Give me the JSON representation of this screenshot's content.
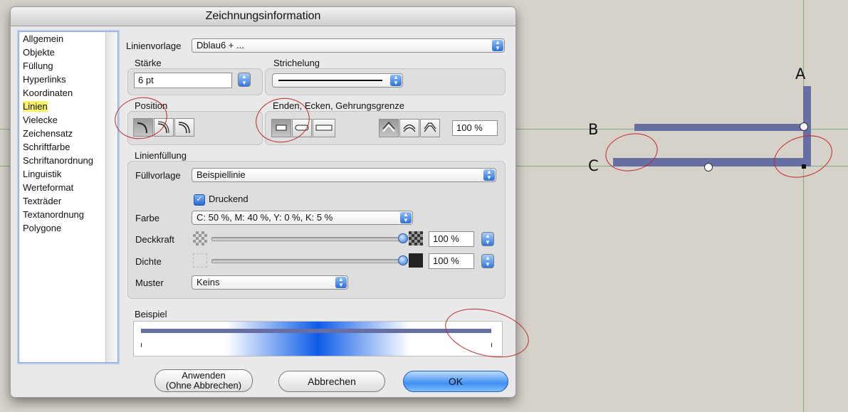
{
  "dialog": {
    "title": "Zeichnungsinformation",
    "categories": [
      "Allgemein",
      "Objekte",
      "Füllung",
      "Hyperlinks",
      "Koordinaten",
      "Linien",
      "Vielecke",
      "Zeichensatz",
      "Schriftfarbe",
      "Schriftanordnung",
      "Linguistik",
      "Werteformat",
      "Texträder",
      "Textanordnung",
      "Polygone"
    ],
    "selected_category": "Linien",
    "linienvorlage": {
      "label": "Linienvorlage",
      "value": "Dblau6 + ..."
    },
    "staerke": {
      "label": "Stärke",
      "value": "6 pt"
    },
    "strichelung": {
      "label": "Strichelung"
    },
    "position": {
      "label": "Position"
    },
    "enden": {
      "label": "Enden, Ecken, Gehrungsgrenze",
      "miter_value": "100 %"
    },
    "linienfuellung": {
      "label": "Linienfüllung",
      "fuellvorlage": {
        "label": "Füllvorlage",
        "value": "Beispiellinie"
      },
      "druckend": {
        "label": "Druckend",
        "checked": true
      },
      "farbe": {
        "label": "Farbe",
        "value": "C: 50 %, M: 40 %, Y: 0 %, K: 5 %"
      },
      "deckkraft": {
        "label": "Deckkraft",
        "value": "100 %",
        "level": 1.0
      },
      "dichte": {
        "label": "Dichte",
        "value": "100 %",
        "level": 1.0
      },
      "muster": {
        "label": "Muster",
        "value": "Keins"
      }
    },
    "beispiel": {
      "label": "Beispiel"
    },
    "buttons": {
      "apply_line1": "Anwenden",
      "apply_line2": "(Ohne Abbrechen)",
      "cancel": "Abbrechen",
      "ok": "OK"
    }
  },
  "canvas": {
    "label_a": "A",
    "label_b": "B",
    "label_c": "C",
    "line_color": "#666ea3"
  },
  "colors": {
    "accent": "#3e8ff0",
    "annotation": "#c0262a",
    "highlight": "#fbf16a"
  }
}
